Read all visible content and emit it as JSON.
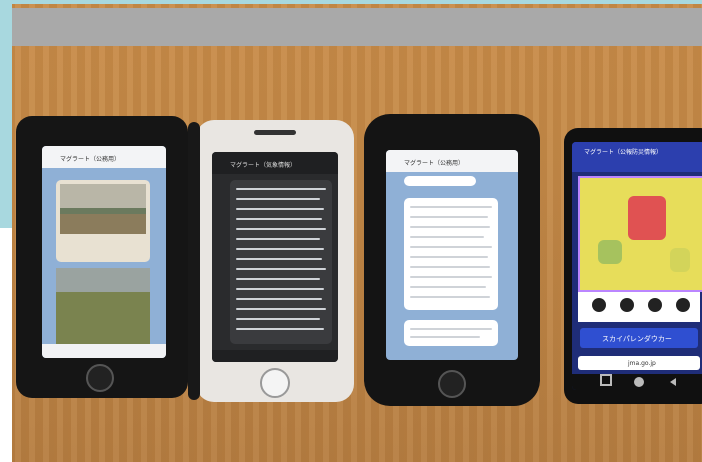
{
  "scene": {
    "description_colors": {
      "table": "#c48a49",
      "frame": "#a8d8df",
      "band": "#a9a9a9"
    }
  },
  "phones": [
    {
      "id": "phone-1",
      "header": "マグラート（公務用）",
      "type": "line-chat-photos"
    },
    {
      "id": "phone-2",
      "header": "マグラート（気象情報）",
      "type": "line-chat-list"
    },
    {
      "id": "phone-3",
      "header": "マグラート（公務用）",
      "type": "line-chat-text"
    },
    {
      "id": "phone-4",
      "header": "マグラート（公報防災情報）",
      "banner": "スカイパレンダウカー",
      "url": "jma.go.jp",
      "type": "map-app"
    }
  ]
}
